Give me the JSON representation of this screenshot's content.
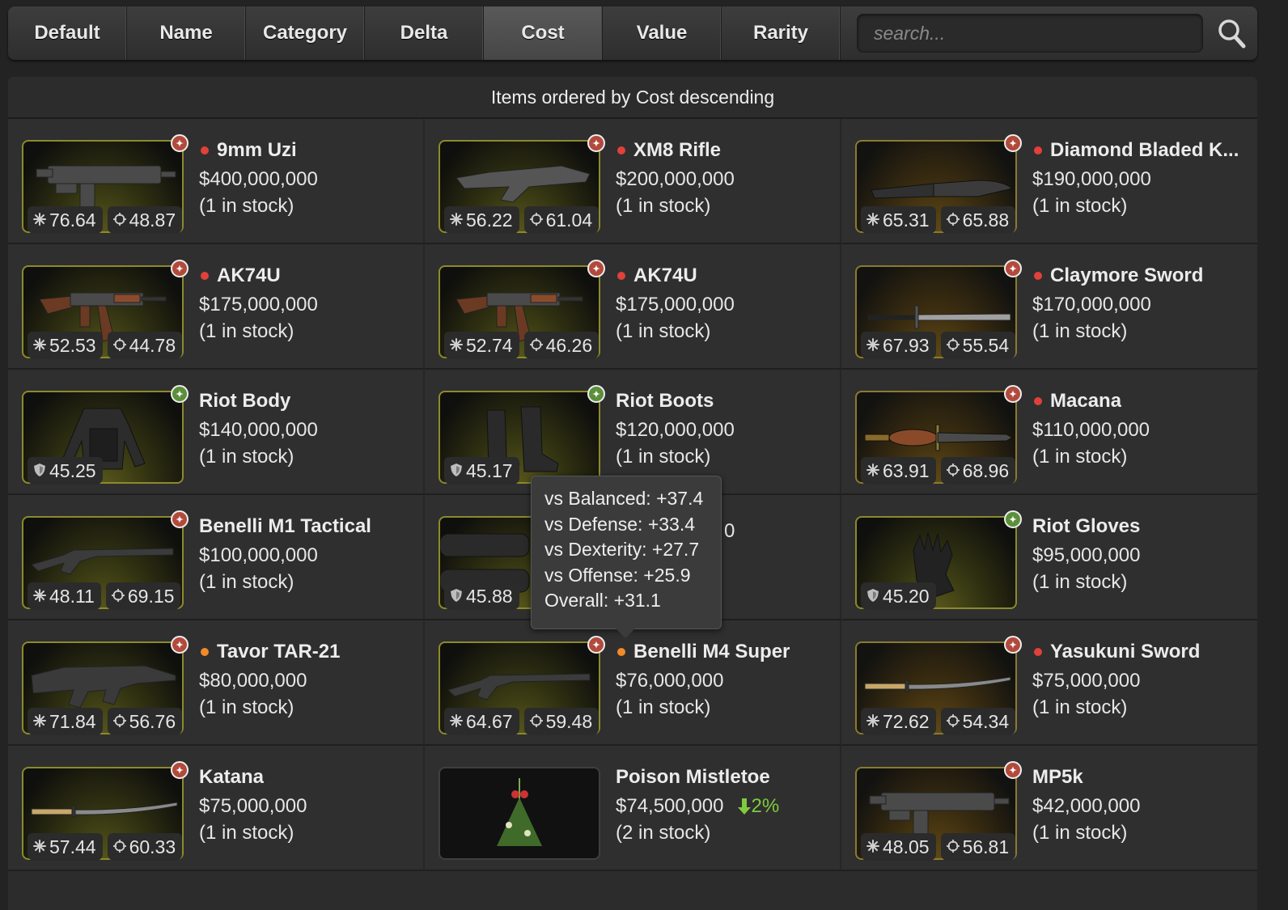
{
  "sort_tabs": [
    "Default",
    "Name",
    "Category",
    "Delta",
    "Cost",
    "Value",
    "Rarity"
  ],
  "active_tab": "Cost",
  "search": {
    "placeholder": "search..."
  },
  "panel": {
    "heading": "Items ordered by Cost descending"
  },
  "tooltip": [
    "vs Balanced: +37.4",
    "vs Defense: +33.4",
    "vs Dexterity: +27.7",
    "vs Offense: +25.9",
    "Overall: +31.1"
  ],
  "colors": {
    "dot_red": "#e0413a",
    "dot_orange": "#f08a2a",
    "delta_green": "#7fcb3d",
    "thumb_border": "#8c8a2b"
  },
  "items": [
    {
      "name": "9mm Uzi",
      "price": "$400,000,000",
      "stock": "(1 in stock)",
      "dot": "red",
      "stat1": "76.64",
      "stat2": "48.87",
      "kind": "weapon",
      "icon": "smg-icon",
      "badge": "red"
    },
    {
      "name": "XM8 Rifle",
      "price": "$200,000,000",
      "stock": "(1 in stock)",
      "dot": "red",
      "stat1": "56.22",
      "stat2": "61.04",
      "kind": "weapon",
      "icon": "rifle-icon",
      "badge": "red"
    },
    {
      "name": "Diamond Bladed K...",
      "price": "$190,000,000",
      "stock": "(1 in stock)",
      "dot": "red",
      "stat1": "65.31",
      "stat2": "65.88",
      "kind": "melee",
      "icon": "knife-icon",
      "badge": "red"
    },
    {
      "name": "AK74U",
      "price": "$175,000,000",
      "stock": "(1 in stock)",
      "dot": "red",
      "stat1": "52.53",
      "stat2": "44.78",
      "kind": "weapon",
      "icon": "ak-rifle-icon",
      "badge": "red"
    },
    {
      "name": "AK74U",
      "price": "$175,000,000",
      "stock": "(1 in stock)",
      "dot": "red",
      "stat1": "52.74",
      "stat2": "46.26",
      "kind": "weapon",
      "icon": "ak-rifle-icon",
      "badge": "red"
    },
    {
      "name": "Claymore Sword",
      "price": "$170,000,000",
      "stock": "(1 in stock)",
      "dot": "red",
      "stat1": "67.93",
      "stat2": "55.54",
      "kind": "melee",
      "icon": "sword-icon",
      "badge": "red"
    },
    {
      "name": "Riot Body",
      "price": "$140,000,000",
      "stock": "(1 in stock)",
      "dot": "",
      "stat1": "45.25",
      "stat2": "",
      "kind": "armor",
      "icon": "body-armor-icon",
      "badge": "green"
    },
    {
      "name": "Riot Boots",
      "price": "$120,000,000",
      "stock": "(1 in stock)",
      "dot": "",
      "stat1": "45.17",
      "stat2": "",
      "kind": "armor",
      "icon": "boots-icon",
      "badge": "green"
    },
    {
      "name": "Macana",
      "price": "$110,000,000",
      "stock": "(1 in stock)",
      "dot": "red",
      "stat1": "63.91",
      "stat2": "68.96",
      "kind": "melee",
      "icon": "spear-icon",
      "badge": "red"
    },
    {
      "name": "Benelli M1 Tactical",
      "price": "$100,000,000",
      "stock": "(1 in stock)",
      "dot": "",
      "stat1": "48.11",
      "stat2": "69.15",
      "kind": "weapon",
      "icon": "shotgun-icon",
      "badge": "red"
    },
    {
      "name": "",
      "price": "0",
      "stock": "",
      "dot": "",
      "stat1": "45.88",
      "stat2": "",
      "kind": "armor",
      "icon": "leggings-icon",
      "badge": ""
    },
    {
      "name": "Riot Gloves",
      "price": "$95,000,000",
      "stock": "(1 in stock)",
      "dot": "",
      "stat1": "45.20",
      "stat2": "",
      "kind": "armor",
      "icon": "gloves-icon",
      "badge": "green"
    },
    {
      "name": "Tavor TAR-21",
      "price": "$80,000,000",
      "stock": "(1 in stock)",
      "dot": "orange",
      "stat1": "71.84",
      "stat2": "56.76",
      "kind": "weapon",
      "icon": "bullpup-rifle-icon",
      "badge": "red"
    },
    {
      "name": "Benelli M4 Super",
      "price": "$76,000,000",
      "stock": "(1 in stock)",
      "dot": "orange",
      "stat1": "64.67",
      "stat2": "59.48",
      "kind": "weapon",
      "icon": "shotgun-icon",
      "badge": "red"
    },
    {
      "name": "Yasukuni Sword",
      "price": "$75,000,000",
      "stock": "(1 in stock)",
      "dot": "red",
      "stat1": "72.62",
      "stat2": "54.34",
      "kind": "melee",
      "icon": "katana-icon",
      "badge": "red"
    },
    {
      "name": "Katana",
      "price": "$75,000,000",
      "stock": "(1 in stock)",
      "dot": "",
      "stat1": "57.44",
      "stat2": "60.33",
      "kind": "weapon",
      "icon": "katana-icon",
      "badge": "red"
    },
    {
      "name": "Poison Mistletoe",
      "price": "$74,500,000",
      "stock": "(2 in stock)",
      "dot": "",
      "stat1": "",
      "stat2": "",
      "kind": "plain",
      "icon": "mistletoe-icon",
      "badge": "",
      "delta": "2%"
    },
    {
      "name": "MP5k",
      "price": "$42,000,000",
      "stock": "(1 in stock)",
      "dot": "",
      "stat1": "48.05",
      "stat2": "56.81",
      "kind": "melee",
      "icon": "smg-icon",
      "badge": "red"
    }
  ]
}
